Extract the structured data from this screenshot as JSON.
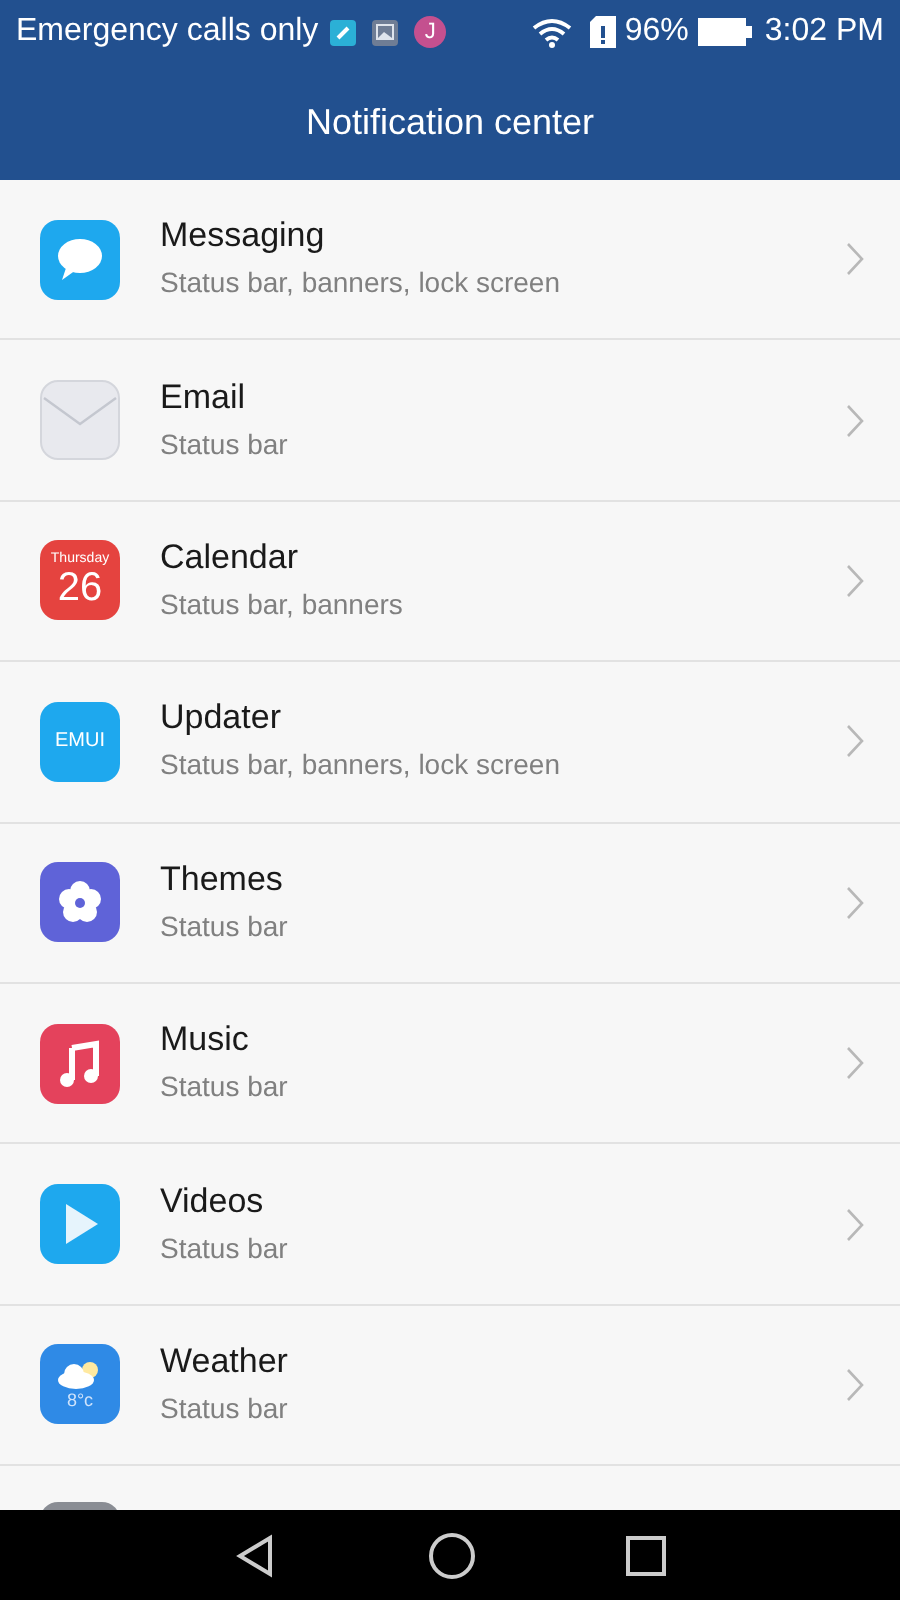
{
  "status_bar": {
    "carrier": "Emergency calls only",
    "contact_initial": "J",
    "battery": "96%",
    "time": "3:02 PM"
  },
  "title": "Notification center",
  "apps": [
    {
      "kind": "messaging",
      "name": "Messaging",
      "channels": "Status bar, banners, lock screen"
    },
    {
      "kind": "email",
      "name": "Email",
      "channels": "Status bar"
    },
    {
      "kind": "calendar",
      "name": "Calendar",
      "channels": "Status bar, banners",
      "icon_day": "Thursday",
      "icon_date": "26"
    },
    {
      "kind": "updater",
      "name": "Updater",
      "channels": "Status bar, banners, lock screen",
      "icon_text": "EMUI"
    },
    {
      "kind": "themes",
      "name": "Themes",
      "channels": "Status bar"
    },
    {
      "kind": "music",
      "name": "Music",
      "channels": "Status bar"
    },
    {
      "kind": "videos",
      "name": "Videos",
      "channels": "Status bar"
    },
    {
      "kind": "weather",
      "name": "Weather",
      "channels": "Status bar",
      "icon_text": "8°c"
    }
  ]
}
